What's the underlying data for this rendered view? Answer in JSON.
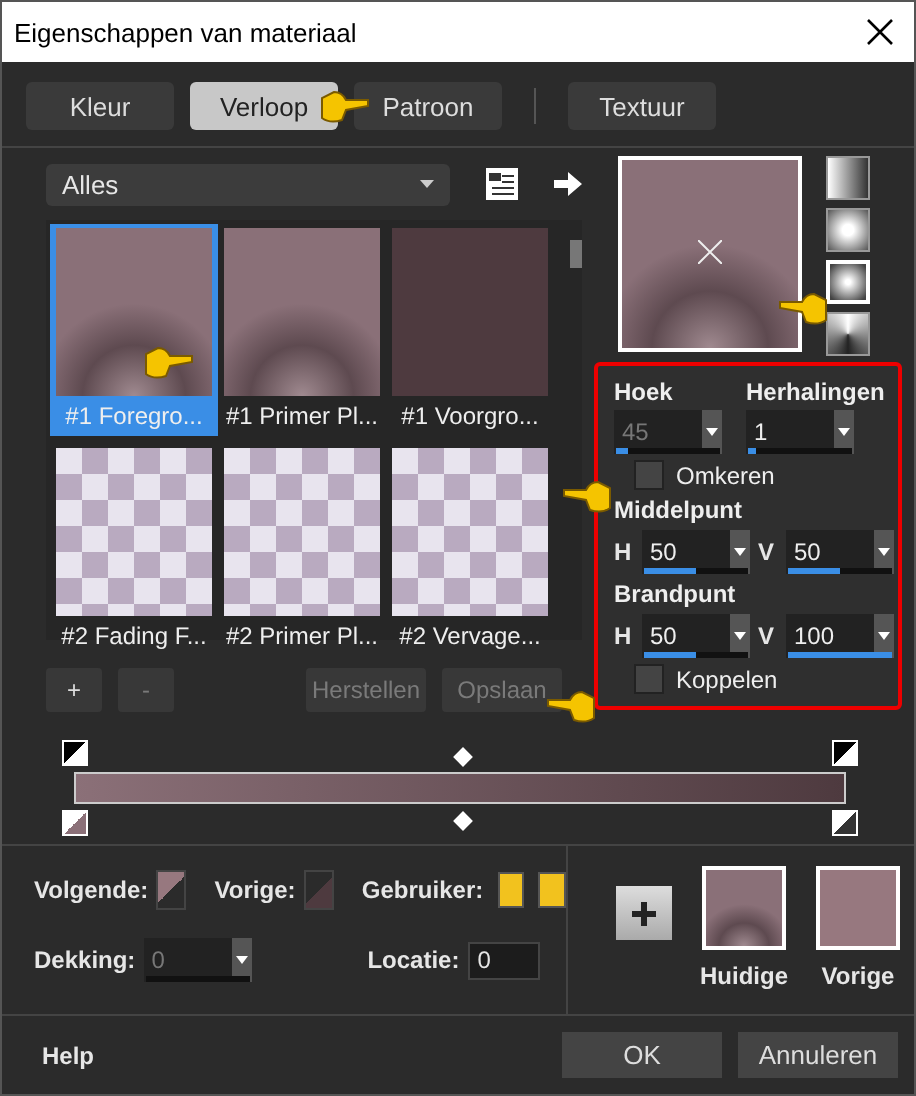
{
  "window": {
    "title": "Eigenschappen van materiaal"
  },
  "tabs": [
    {
      "label": "Kleur",
      "selected": false
    },
    {
      "label": "Verloop",
      "selected": true
    },
    {
      "label": "Patroon",
      "selected": false
    },
    {
      "label": "Textuur",
      "selected": false
    }
  ],
  "filter": {
    "value": "Alles"
  },
  "presets": [
    {
      "label": "#1 Foregro...",
      "selected": true,
      "kind": "radial"
    },
    {
      "label": "#1 Primer Pl...",
      "selected": false,
      "kind": "radial"
    },
    {
      "label": "#1 Voorgro...",
      "selected": false,
      "kind": "flat"
    },
    {
      "label": "#2 Fading F...",
      "selected": false,
      "kind": "checker"
    },
    {
      "label": "#2 Primer Pl...",
      "selected": false,
      "kind": "checker"
    },
    {
      "label": "#2 Vervage...",
      "selected": false,
      "kind": "checker"
    }
  ],
  "list_buttons": [
    {
      "label": "+",
      "disabled": false
    },
    {
      "label": "-",
      "disabled": true
    },
    {
      "label": "Herstellen",
      "disabled": true
    },
    {
      "label": "Opslaan",
      "disabled": true
    }
  ],
  "styles": [
    {
      "kind": "linear",
      "selected": false
    },
    {
      "kind": "rectangular",
      "selected": false
    },
    {
      "kind": "radial",
      "selected": true
    },
    {
      "kind": "sunburst",
      "selected": false
    }
  ],
  "settings": {
    "angle": {
      "label": "Hoek",
      "value": "45",
      "disabled": true,
      "level": 0.12
    },
    "repeats": {
      "label": "Herhalingen",
      "value": "1",
      "disabled": false,
      "level": 0.08
    },
    "invert": {
      "label": "Omkeren",
      "checked": false
    },
    "center": {
      "label": "Middelpunt",
      "fields": [
        {
          "axis": "H",
          "value": "50",
          "level": 0.5
        },
        {
          "axis": "V",
          "value": "50",
          "level": 0.5
        }
      ]
    },
    "focal": {
      "label": "Brandpunt",
      "fields": [
        {
          "axis": "H",
          "value": "50",
          "level": 0.5
        },
        {
          "axis": "V",
          "value": "100",
          "level": 1
        }
      ]
    },
    "link": {
      "label": "Koppelen",
      "checked": false
    }
  },
  "bottom": {
    "next": "Volgende:",
    "previous": "Vorige:",
    "user": {
      "label": "Gebruiker:",
      "chips": [
        {
          "color": "#f2c21e"
        },
        {
          "color": "#f2c21e"
        }
      ]
    },
    "opacity": {
      "label": "Dekking:",
      "value": "0",
      "disabled": true
    },
    "location": {
      "label": "Locatie:",
      "value": "0"
    }
  },
  "swatches": [
    {
      "label": "Huidige",
      "kind": "gradient"
    },
    {
      "label": "Vorige",
      "kind": "flat"
    }
  ],
  "footer": {
    "help": "Help",
    "buttons": [
      "OK",
      "Annuleren"
    ]
  }
}
